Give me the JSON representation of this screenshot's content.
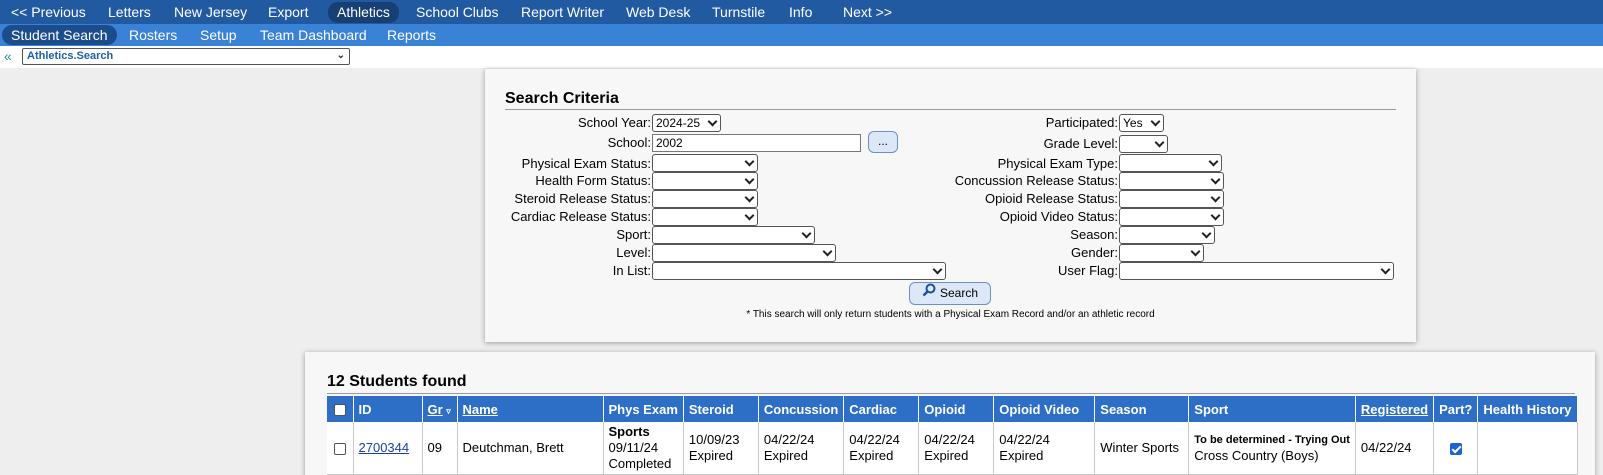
{
  "top_menu": [
    {
      "label": "<< Previous",
      "active": false
    },
    {
      "label": "Letters",
      "active": false
    },
    {
      "label": "New Jersey",
      "active": false
    },
    {
      "label": "Export",
      "active": false
    },
    {
      "label": "Athletics",
      "active": true
    },
    {
      "label": "School Clubs",
      "active": false
    },
    {
      "label": "Report Writer",
      "active": false
    },
    {
      "label": "Web Desk",
      "active": false
    },
    {
      "label": "Turnstile",
      "active": false
    },
    {
      "label": "Info",
      "active": false
    },
    {
      "label": "Next >>",
      "active": false
    }
  ],
  "sub_menu": [
    {
      "label": "Student Search",
      "active": true
    },
    {
      "label": "Rosters",
      "active": false
    },
    {
      "label": "Setup",
      "active": false
    },
    {
      "label": "Team Dashboard",
      "active": false
    },
    {
      "label": "Reports",
      "active": false
    }
  ],
  "breadcrumb": {
    "back": "«",
    "selected": "Athletics.Search"
  },
  "criteria": {
    "title": "Search Criteria",
    "school_year": {
      "label": "School Year:",
      "value": "2024-25"
    },
    "school": {
      "label": "School:",
      "value": "2002",
      "lookup_label": "..."
    },
    "physical_exam_status": {
      "label": "Physical Exam Status:",
      "value": ""
    },
    "health_form_status": {
      "label": "Health Form Status:",
      "value": ""
    },
    "steroid_release_status": {
      "label": "Steroid Release Status:",
      "value": ""
    },
    "cardiac_release_status": {
      "label": "Cardiac Release Status:",
      "value": ""
    },
    "sport": {
      "label": "Sport:",
      "value": ""
    },
    "level": {
      "label": "Level:",
      "value": ""
    },
    "in_list": {
      "label": "In List:",
      "value": ""
    },
    "participated": {
      "label": "Participated:",
      "value": "Yes"
    },
    "grade_level": {
      "label": "Grade Level:",
      "value": ""
    },
    "physical_exam_type": {
      "label": "Physical Exam Type:",
      "value": ""
    },
    "concussion_release_status": {
      "label": "Concussion Release Status:",
      "value": ""
    },
    "opioid_release_status": {
      "label": "Opioid Release Status:",
      "value": ""
    },
    "opioid_video_status": {
      "label": "Opioid Video Status:",
      "value": ""
    },
    "season": {
      "label": "Season:",
      "value": ""
    },
    "gender": {
      "label": "Gender:",
      "value": ""
    },
    "user_flag": {
      "label": "User Flag:",
      "value": ""
    },
    "search_button": "Search",
    "note": "* This search will only return students with a Physical Exam Record and/or an athletic record"
  },
  "results": {
    "count_label": "12 Students found",
    "headers": {
      "id": "ID",
      "gr": "Gr",
      "name": "Name",
      "phys_exam": "Phys Exam",
      "steroid": "Steroid",
      "concussion": "Concussion",
      "cardiac": "Cardiac",
      "opioid": "Opioid",
      "opioid_video": "Opioid Video",
      "season": "Season",
      "sport": "Sport",
      "registered": "Registered",
      "part": "Part?",
      "health_history": "Health History"
    },
    "rows": [
      {
        "id": "2700344",
        "gr": "09",
        "name": "Deutchman, Brett",
        "phys_exam_title": "Sports",
        "phys_exam_date": "09/11/24",
        "phys_exam_status": "Completed",
        "steroid_date": "10/09/23",
        "steroid_status": "Expired",
        "concussion_date": "04/22/24",
        "concussion_status": "Expired",
        "cardiac_date": "04/22/24",
        "cardiac_status": "Expired",
        "opioid_date": "04/22/24",
        "opioid_status": "Expired",
        "opioid_video_date": "04/22/24",
        "opioid_video_status": "Expired",
        "season": "Winter Sports",
        "sport_note": "To be determined - Trying Out",
        "sport": "Cross Country (Boys)",
        "registered": "04/22/24",
        "participated": true,
        "health_history": ""
      }
    ]
  },
  "colors": {
    "top_bar": "#215aa0",
    "sub_bar": "#3a82d6",
    "table_header": "#2d6fc7"
  }
}
